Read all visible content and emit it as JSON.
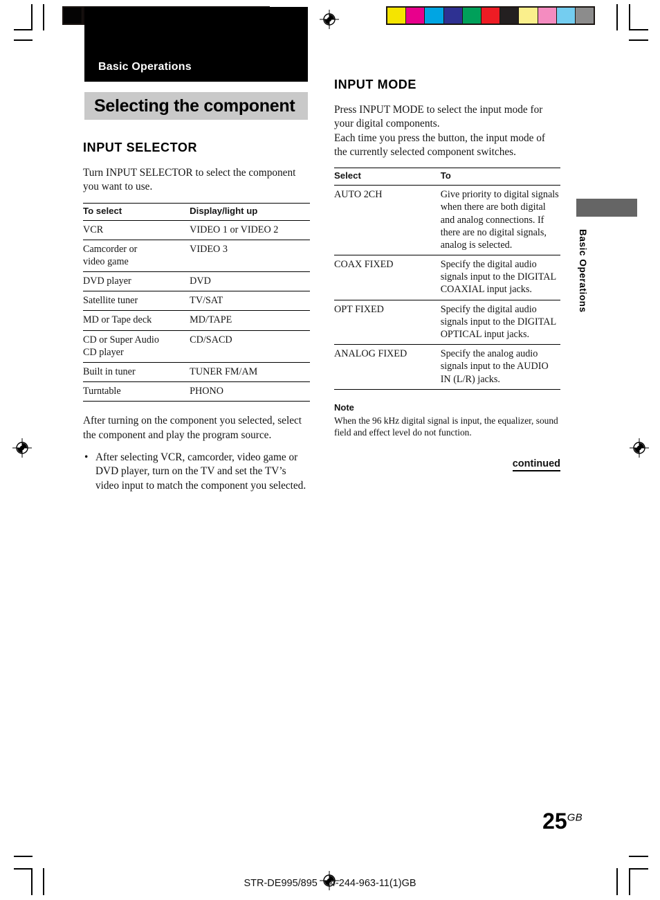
{
  "press_marks": {
    "gray_scale_patches": [
      "#050404",
      "#120d0c",
      "#1d1715",
      "#2a2220",
      "#3a302d",
      "#4b403c",
      "#645853",
      "#847871",
      "#a79c95",
      "#cec5bf",
      "#ffffff"
    ],
    "color_patches": [
      "#f5e400",
      "#e8008c",
      "#00a5e3",
      "#2e3192",
      "#00a05a",
      "#ed1c24",
      "#231f20",
      "#faef8c",
      "#f48cc0",
      "#74cdf0",
      "#8c8c8c"
    ],
    "registration_icon": "registration-target-icon"
  },
  "page": {
    "chapter_banner_label": "Basic Operations",
    "section_title": "Selecting the component",
    "side_tab_label": "Basic Operations",
    "folio_number": "25",
    "folio_suffix": "GB",
    "footer_model": "STR-DE995/895",
    "footer_partcode": "4-244-963-11(1)GB"
  },
  "left_column": {
    "heading": "INPUT SELECTOR",
    "intro": "Turn INPUT SELECTOR to select the component you want to use.",
    "table": {
      "headers": [
        "To select",
        "Display/light up"
      ],
      "rows": [
        [
          "VCR",
          "VIDEO 1 or VIDEO 2"
        ],
        [
          "Camcorder or\nvideo game",
          "VIDEO 3"
        ],
        [
          "DVD player",
          "DVD"
        ],
        [
          "Satellite tuner",
          "TV/SAT"
        ],
        [
          "MD or Tape deck",
          "MD/TAPE"
        ],
        [
          "CD or Super Audio\nCD player",
          "CD/SACD"
        ],
        [
          "Built in tuner",
          "TUNER FM/AM"
        ],
        [
          "Turntable",
          "PHONO"
        ]
      ]
    },
    "after_text": "After turning on the component you selected, select the component and play the program source.",
    "bullets": [
      "After selecting VCR, camcorder, video game or DVD player, turn on the TV and set the TV’s video input to match the component you selected."
    ],
    "bullet_glyph": "•"
  },
  "right_column": {
    "heading": "INPUT MODE",
    "intro_1": "Press INPUT MODE to select the input mode for your digital components.",
    "intro_2": "Each time you press the button, the input mode of the currently selected component switches.",
    "table": {
      "headers": [
        "Select",
        "To"
      ],
      "rows": [
        [
          "AUTO 2CH",
          "Give priority to digital signals when there are both digital and analog connections. If there are no digital signals, analog is selected."
        ],
        [
          "COAX FIXED",
          "Specify the digital audio signals input to the DIGITAL COAXIAL input jacks."
        ],
        [
          "OPT FIXED",
          "Specify the digital audio signals input to the DIGITAL OPTICAL input jacks."
        ],
        [
          "ANALOG FIXED",
          "Specify the analog audio signals input to the AUDIO IN (L/R) jacks."
        ]
      ]
    },
    "note_heading": "Note",
    "note_body": "When the 96 kHz digital signal is input, the equalizer, sound field and effect level do not function.",
    "continued_label": "continued"
  }
}
